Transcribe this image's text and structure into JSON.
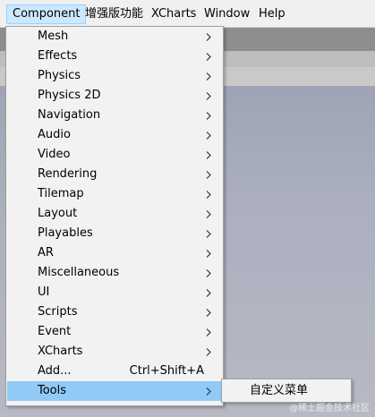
{
  "menubar": {
    "items": [
      {
        "label": "Component",
        "active": true
      },
      {
        "label": "增强版功能",
        "active": false
      },
      {
        "label": "XCharts",
        "active": false
      },
      {
        "label": "Window",
        "active": false
      },
      {
        "label": "Help",
        "active": false
      }
    ]
  },
  "component_menu": {
    "items": [
      {
        "label": "Mesh",
        "submenu": true
      },
      {
        "label": "Effects",
        "submenu": true
      },
      {
        "label": "Physics",
        "submenu": true
      },
      {
        "label": "Physics 2D",
        "submenu": true
      },
      {
        "label": "Navigation",
        "submenu": true
      },
      {
        "label": "Audio",
        "submenu": true
      },
      {
        "label": "Video",
        "submenu": true
      },
      {
        "label": "Rendering",
        "submenu": true
      },
      {
        "label": "Tilemap",
        "submenu": true
      },
      {
        "label": "Layout",
        "submenu": true
      },
      {
        "label": "Playables",
        "submenu": true
      },
      {
        "label": "AR",
        "submenu": true
      },
      {
        "label": "Miscellaneous",
        "submenu": true
      },
      {
        "label": "UI",
        "submenu": true
      },
      {
        "label": "Scripts",
        "submenu": true
      },
      {
        "label": "Event",
        "submenu": true
      },
      {
        "label": "XCharts",
        "submenu": true
      },
      {
        "label": "Add...",
        "submenu": false,
        "shortcut": "Ctrl+Shift+A"
      },
      {
        "label": "Tools",
        "submenu": true,
        "highlighted": true
      }
    ]
  },
  "tools_submenu": {
    "items": [
      {
        "label": "自定义菜单"
      }
    ]
  },
  "watermark": "@稀土掘金技术社区",
  "colors": {
    "menu_highlight": "#91c9f7",
    "menubar_active": "#cce8ff",
    "menu_background": "#f2f2f2"
  }
}
